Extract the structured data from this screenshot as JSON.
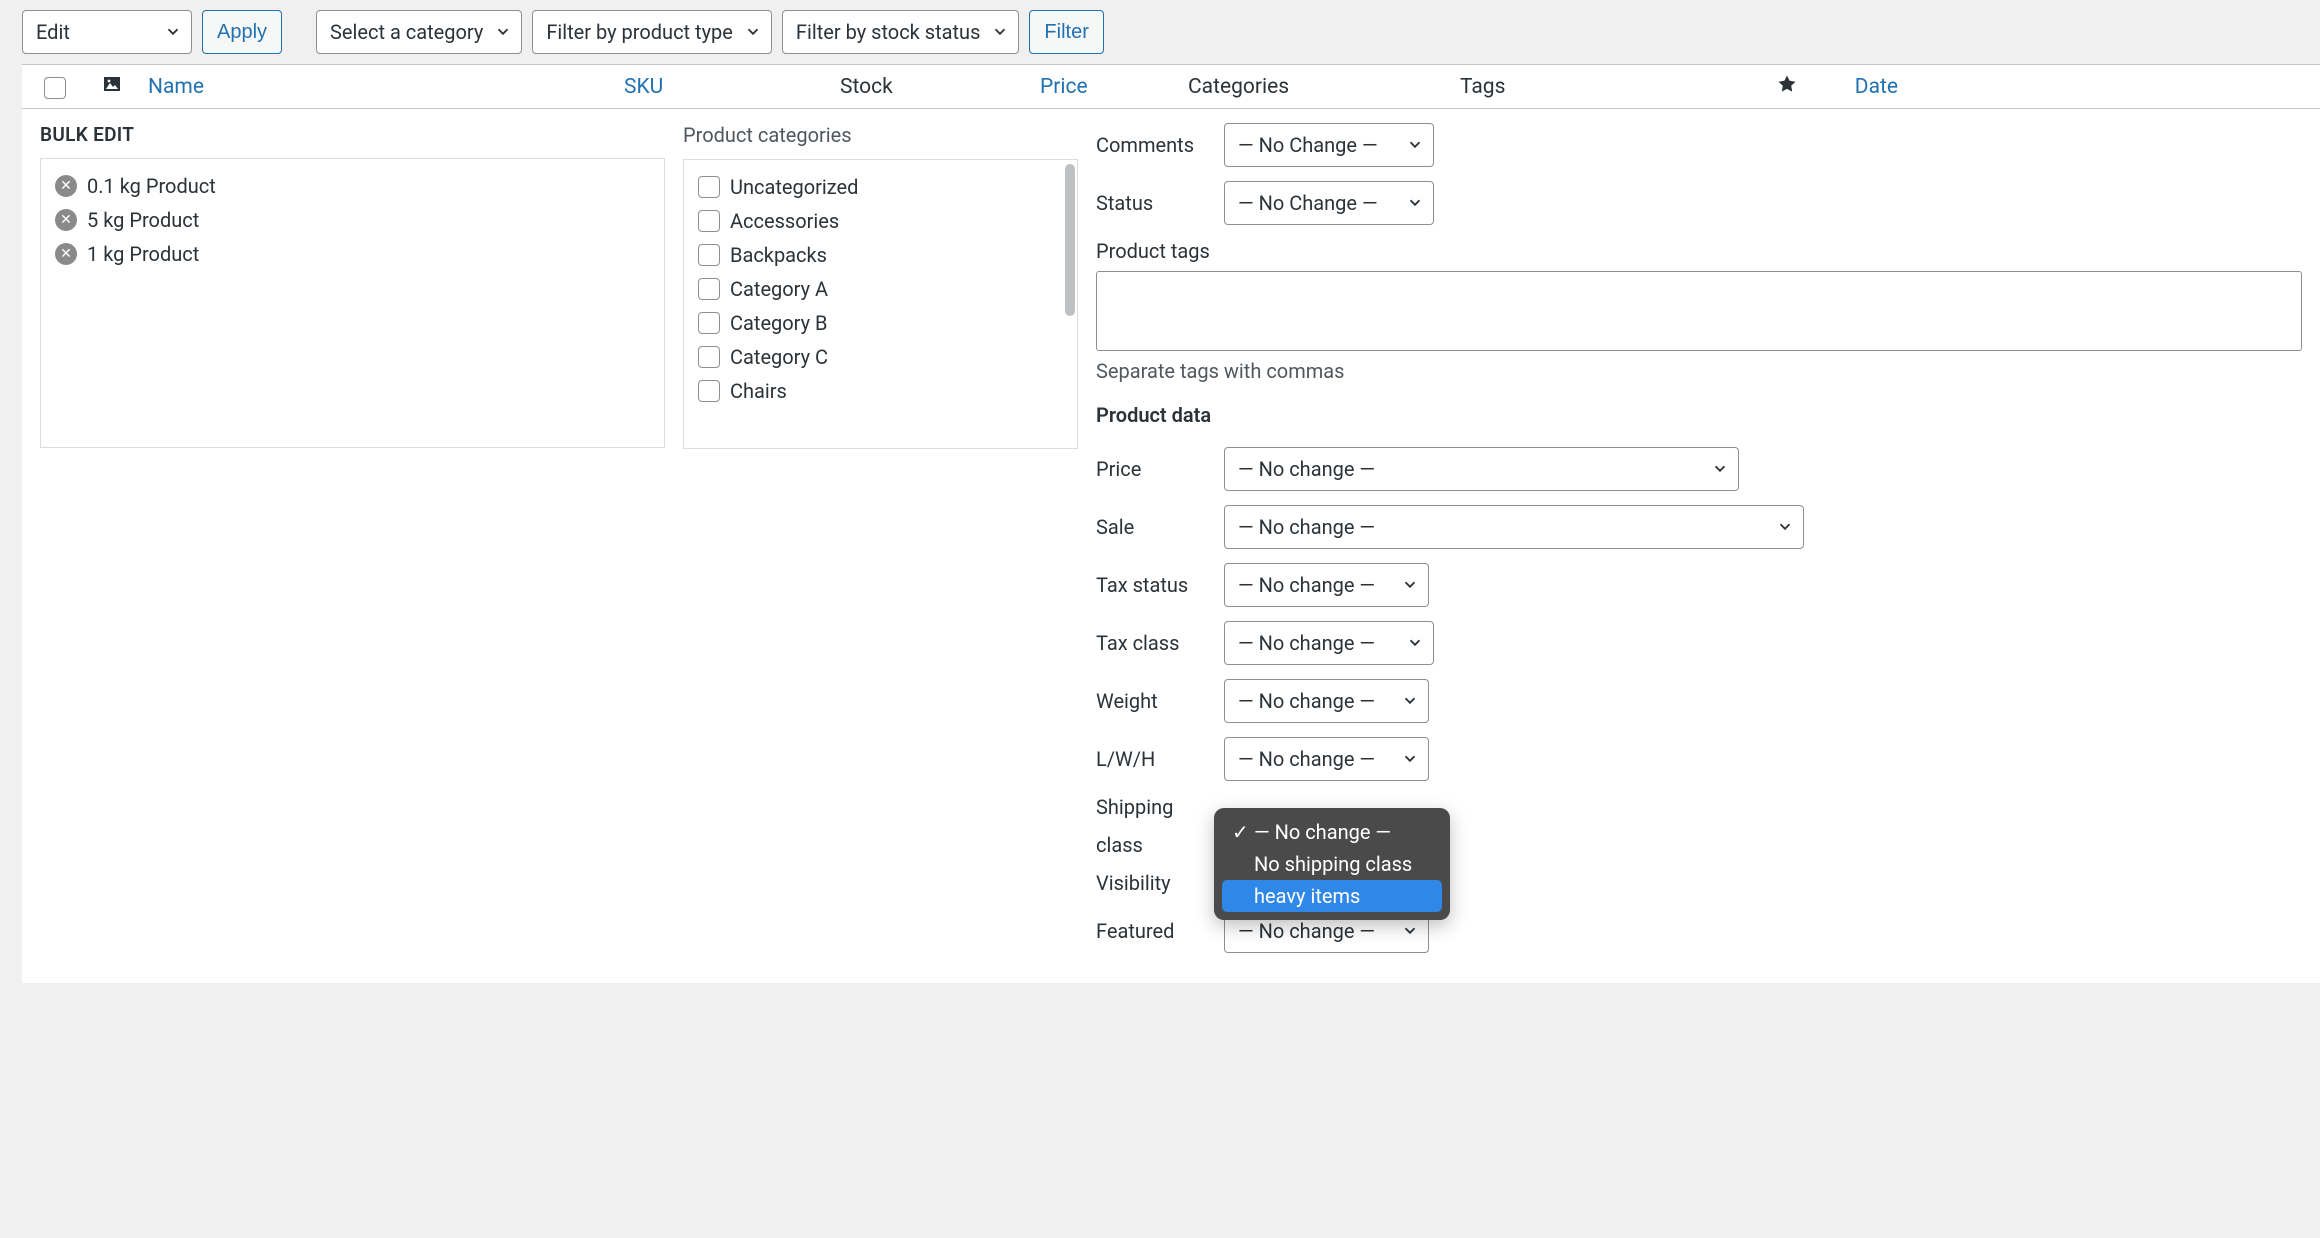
{
  "topbar": {
    "bulk_action": "Edit",
    "apply_label": "Apply",
    "category_filter": "Select a category",
    "type_filter": "Filter by product type",
    "stock_filter": "Filter by stock status",
    "filter_label": "Filter"
  },
  "columns": {
    "name": "Name",
    "sku": "SKU",
    "stock": "Stock",
    "price": "Price",
    "categories": "Categories",
    "tags": "Tags",
    "date": "Date"
  },
  "bulk": {
    "title": "BULK EDIT",
    "products": [
      {
        "label": "0.1 kg Product"
      },
      {
        "label": "5 kg Product"
      },
      {
        "label": "1 kg Product"
      }
    ],
    "cat_heading": "Product categories",
    "categories": [
      "Uncategorized",
      "Accessories",
      "Backpacks",
      "Category A",
      "Category B",
      "Category C",
      "Chairs"
    ],
    "right": {
      "comments_label": "Comments",
      "comments_value": "— No Change —",
      "status_label": "Status",
      "status_value": "— No Change —",
      "tags_label": "Product tags",
      "tags_help": "Separate tags with commas",
      "product_data": "Product data",
      "price_label": "Price",
      "price_value": "— No change —",
      "sale_label": "Sale",
      "sale_value": "— No change —",
      "tax_status_label": "Tax status",
      "tax_status_value": "— No change —",
      "tax_class_label": "Tax class",
      "tax_class_value": "— No change —",
      "weight_label": "Weight",
      "weight_value": "— No change —",
      "lwh_label": "L/W/H",
      "lwh_value": "— No change —",
      "shipping_label_1": "Shipping",
      "shipping_label_2": "class",
      "visibility_label": "Visibility",
      "featured_label": "Featured",
      "featured_value": "— No change —",
      "shipping_options": [
        "— No change —",
        "No shipping class",
        "heavy items"
      ]
    }
  }
}
